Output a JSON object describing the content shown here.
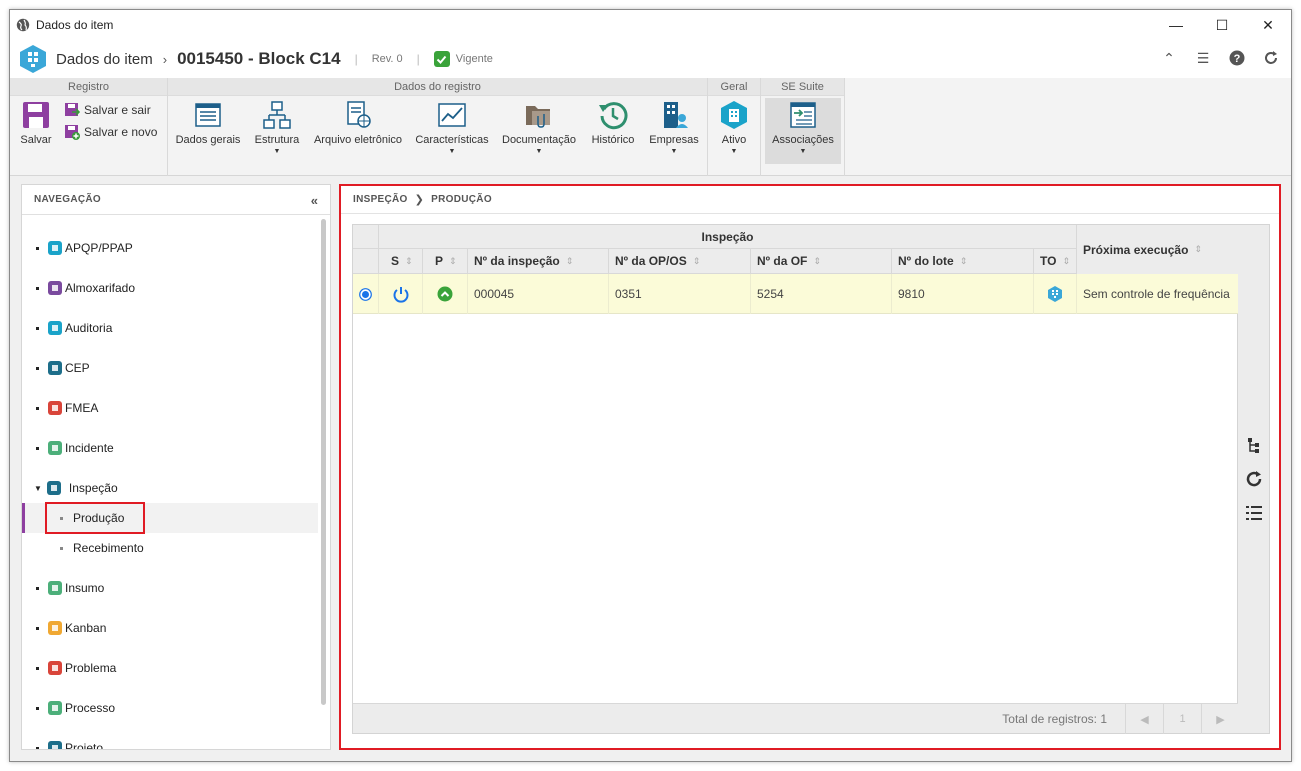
{
  "window": {
    "title": "Dados do item"
  },
  "header": {
    "label": "Dados do item",
    "item": "0015450 - Block C14",
    "rev": "Rev. 0",
    "status": "Vigente"
  },
  "ribbon": {
    "groups": {
      "registro": "Registro",
      "dados_registro": "Dados do registro",
      "geral": "Geral",
      "se_suite": "SE Suite"
    },
    "salvar": "Salvar",
    "salvar_sair": "Salvar e sair",
    "salvar_novo": "Salvar e novo",
    "dados_gerais": "Dados gerais",
    "estrutura": "Estrutura",
    "arquivo_eletronico": "Arquivo eletrônico",
    "caracteristicas": "Características",
    "documentacao": "Documentação",
    "historico": "Histórico",
    "empresas": "Empresas",
    "ativo": "Ativo",
    "associacoes": "Associações"
  },
  "nav": {
    "title": "NAVEGAÇÃO",
    "items": [
      {
        "label": "APQP/PPAP",
        "color": "#1aa3c9"
      },
      {
        "label": "Almoxarifado",
        "color": "#7a4a9e"
      },
      {
        "label": "Auditoria",
        "color": "#1aa3c9"
      },
      {
        "label": "CEP",
        "color": "#1d6e8a"
      },
      {
        "label": "FMEA",
        "color": "#d9453a"
      },
      {
        "label": "Incidente",
        "color": "#4caf7a"
      },
      {
        "label": "Inspeção",
        "color": "#1d6e8a"
      },
      {
        "label": "Insumo",
        "color": "#4caf7a"
      },
      {
        "label": "Kanban",
        "color": "#f0a832"
      },
      {
        "label": "Problema",
        "color": "#d9453a"
      },
      {
        "label": "Processo",
        "color": "#4caf7a"
      },
      {
        "label": "Projeto",
        "color": "#1d6e8a"
      }
    ],
    "subitems": [
      "Produção",
      "Recebimento"
    ]
  },
  "main": {
    "breadcrumb": [
      "INSPEÇÃO",
      "PRODUÇÃO"
    ],
    "group_header": "Inspeção",
    "columns": {
      "s": "S",
      "p": "P",
      "n_inspecao": "Nº da inspeção",
      "n_op": "Nº da OP/OS",
      "n_of": "Nº da OF",
      "n_lote": "Nº do lote",
      "to": "TO",
      "proxima": "Próxima execução"
    },
    "rows": [
      {
        "n_inspecao": "000045",
        "n_op": "0351",
        "n_of": "5254",
        "n_lote": "9810",
        "proxima": "Sem controle de frequência"
      }
    ],
    "total": "Total de registros: 1",
    "page": "1"
  },
  "colors": {
    "highlight": "#e01b24",
    "row_selected": "#fbfbd8",
    "accent": "#8e3fa0"
  }
}
